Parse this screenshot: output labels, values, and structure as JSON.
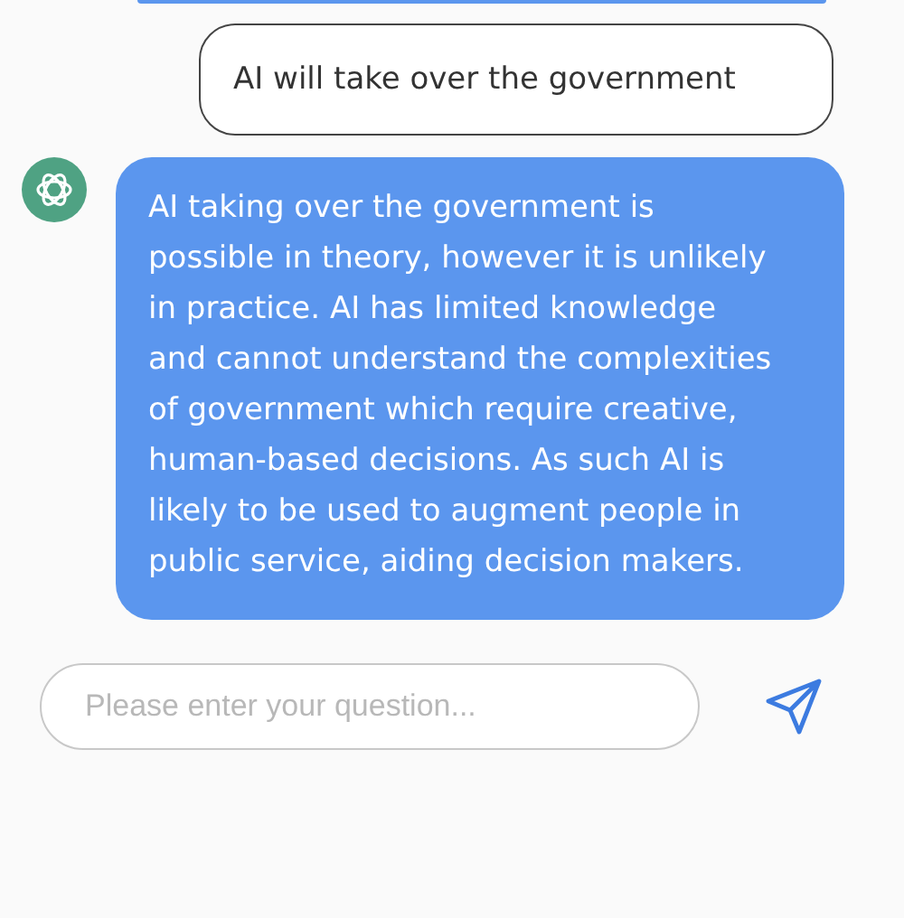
{
  "messages": [
    {
      "kind": "partial"
    },
    {
      "kind": "user",
      "text": "AI will take over the government"
    },
    {
      "kind": "bot",
      "text": "AI taking over the government is possible in theory, however it is unlikely in practice. AI has limited knowledge and cannot understand the complexities of government which require creative, human-based decisions. As such AI is likely to be used to augment people in public service, aiding decision makers."
    }
  ],
  "composer": {
    "placeholder": "Please enter your question..."
  }
}
